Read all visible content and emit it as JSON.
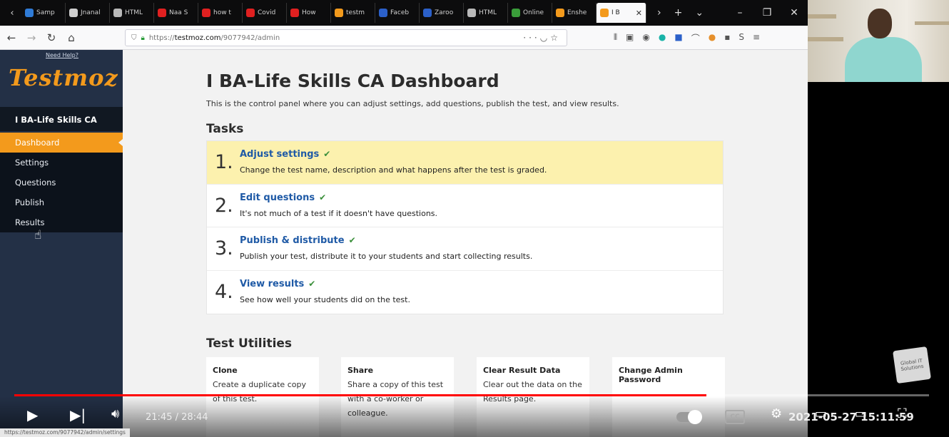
{
  "browser": {
    "tabs": [
      {
        "label": "Samp",
        "color": "#2f7bd6"
      },
      {
        "label": "Jnanal",
        "color": "#cfcfcf"
      },
      {
        "label": "HTML",
        "color": "#b9b9b9"
      },
      {
        "label": "Naa S",
        "color": "#e02020"
      },
      {
        "label": "how t",
        "color": "#e02020"
      },
      {
        "label": "Covid",
        "color": "#e02020"
      },
      {
        "label": "How",
        "color": "#e02020"
      },
      {
        "label": "testm",
        "color": "#f39a1c"
      },
      {
        "label": "Faceb",
        "color": "#2b60c9"
      },
      {
        "label": "Zaroo",
        "color": "#2b60c9"
      },
      {
        "label": "HTML",
        "color": "#b9b9b9"
      },
      {
        "label": "Online",
        "color": "#3a9d3a"
      },
      {
        "label": "Enshe",
        "color": "#f39a1c"
      }
    ],
    "active_tab": {
      "label": "I B",
      "color": "#f39a1c"
    },
    "url_prefix": "https://",
    "url_host": "testmoz.com",
    "url_path": "/9077942/admin",
    "status_url": "https://testmoz.com/9077942/admin/settings"
  },
  "sidebar": {
    "need_help": "Need Help?",
    "logo": "Testmoz",
    "test_name": "I BA-Life Skills CA",
    "items": [
      {
        "label": "Dashboard",
        "active": true
      },
      {
        "label": "Settings",
        "active": false
      },
      {
        "label": "Questions",
        "active": false
      },
      {
        "label": "Publish",
        "active": false
      },
      {
        "label": "Results",
        "active": false
      }
    ]
  },
  "main": {
    "title": "I BA-Life Skills CA Dashboard",
    "description": "This is the control panel where you can adjust settings, add questions, publish the test, and view results.",
    "tasks_heading": "Tasks",
    "tasks": [
      {
        "num": "1.",
        "title": "Adjust settings",
        "text": "Change the test name, description and what happens after the test is graded.",
        "highlight": true
      },
      {
        "num": "2.",
        "title": "Edit questions",
        "text": "It's not much of a test if it doesn't have questions.",
        "highlight": false
      },
      {
        "num": "3.",
        "title": "Publish & distribute",
        "text": "Publish your test, distribute it to your students and start collecting results.",
        "highlight": false
      },
      {
        "num": "4.",
        "title": "View results",
        "text": "See how well your students did on the test.",
        "highlight": false
      }
    ],
    "check_glyph": "✔",
    "utilities_heading": "Test Utilities",
    "utilities": [
      {
        "title": "Clone",
        "text": "Create a duplicate copy of this test."
      },
      {
        "title": "Share",
        "text": "Share a copy of this test with a co-worker or colleague."
      },
      {
        "title": "Clear Result Data",
        "text": "Clear out the data on the Results page."
      },
      {
        "title": "Change Admin Password",
        "text": ""
      }
    ]
  },
  "video": {
    "time": "21:45 / 28:44",
    "progress": 0.757,
    "overlay_text": "2021-05-27 15:11:59",
    "cc_label": "CC",
    "channel_badge": "Global IT Solutions"
  }
}
